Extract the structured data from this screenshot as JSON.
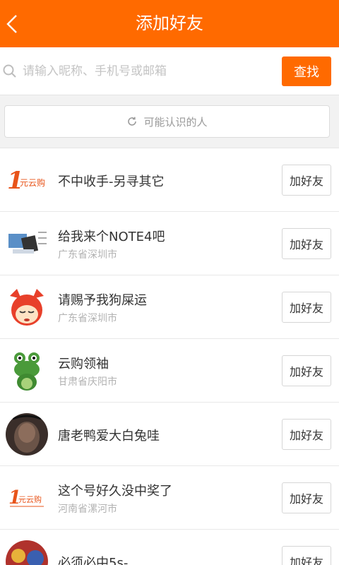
{
  "header": {
    "title": "添加好友"
  },
  "search": {
    "placeholder": "请输入昵称、手机号或邮箱",
    "button": "查找"
  },
  "suggest": {
    "label": "可能认识的人"
  },
  "add_label": "加好友",
  "users": [
    {
      "name": "不中收手-另寻其它",
      "location": ""
    },
    {
      "name": "给我来个NOTE4吧",
      "location": "广东省深圳市"
    },
    {
      "name": "请赐予我狗屎运",
      "location": "广东省深圳市"
    },
    {
      "name": "云购领袖",
      "location": "甘肃省庆阳市"
    },
    {
      "name": "唐老鸭爱大白兔哇",
      "location": ""
    },
    {
      "name": "这个号好久没中奖了",
      "location": "河南省漯河市"
    },
    {
      "name": "必须必中5s-",
      "location": ""
    }
  ],
  "logos": {
    "yyg_mark": "1",
    "yyg_text": "元云购"
  }
}
